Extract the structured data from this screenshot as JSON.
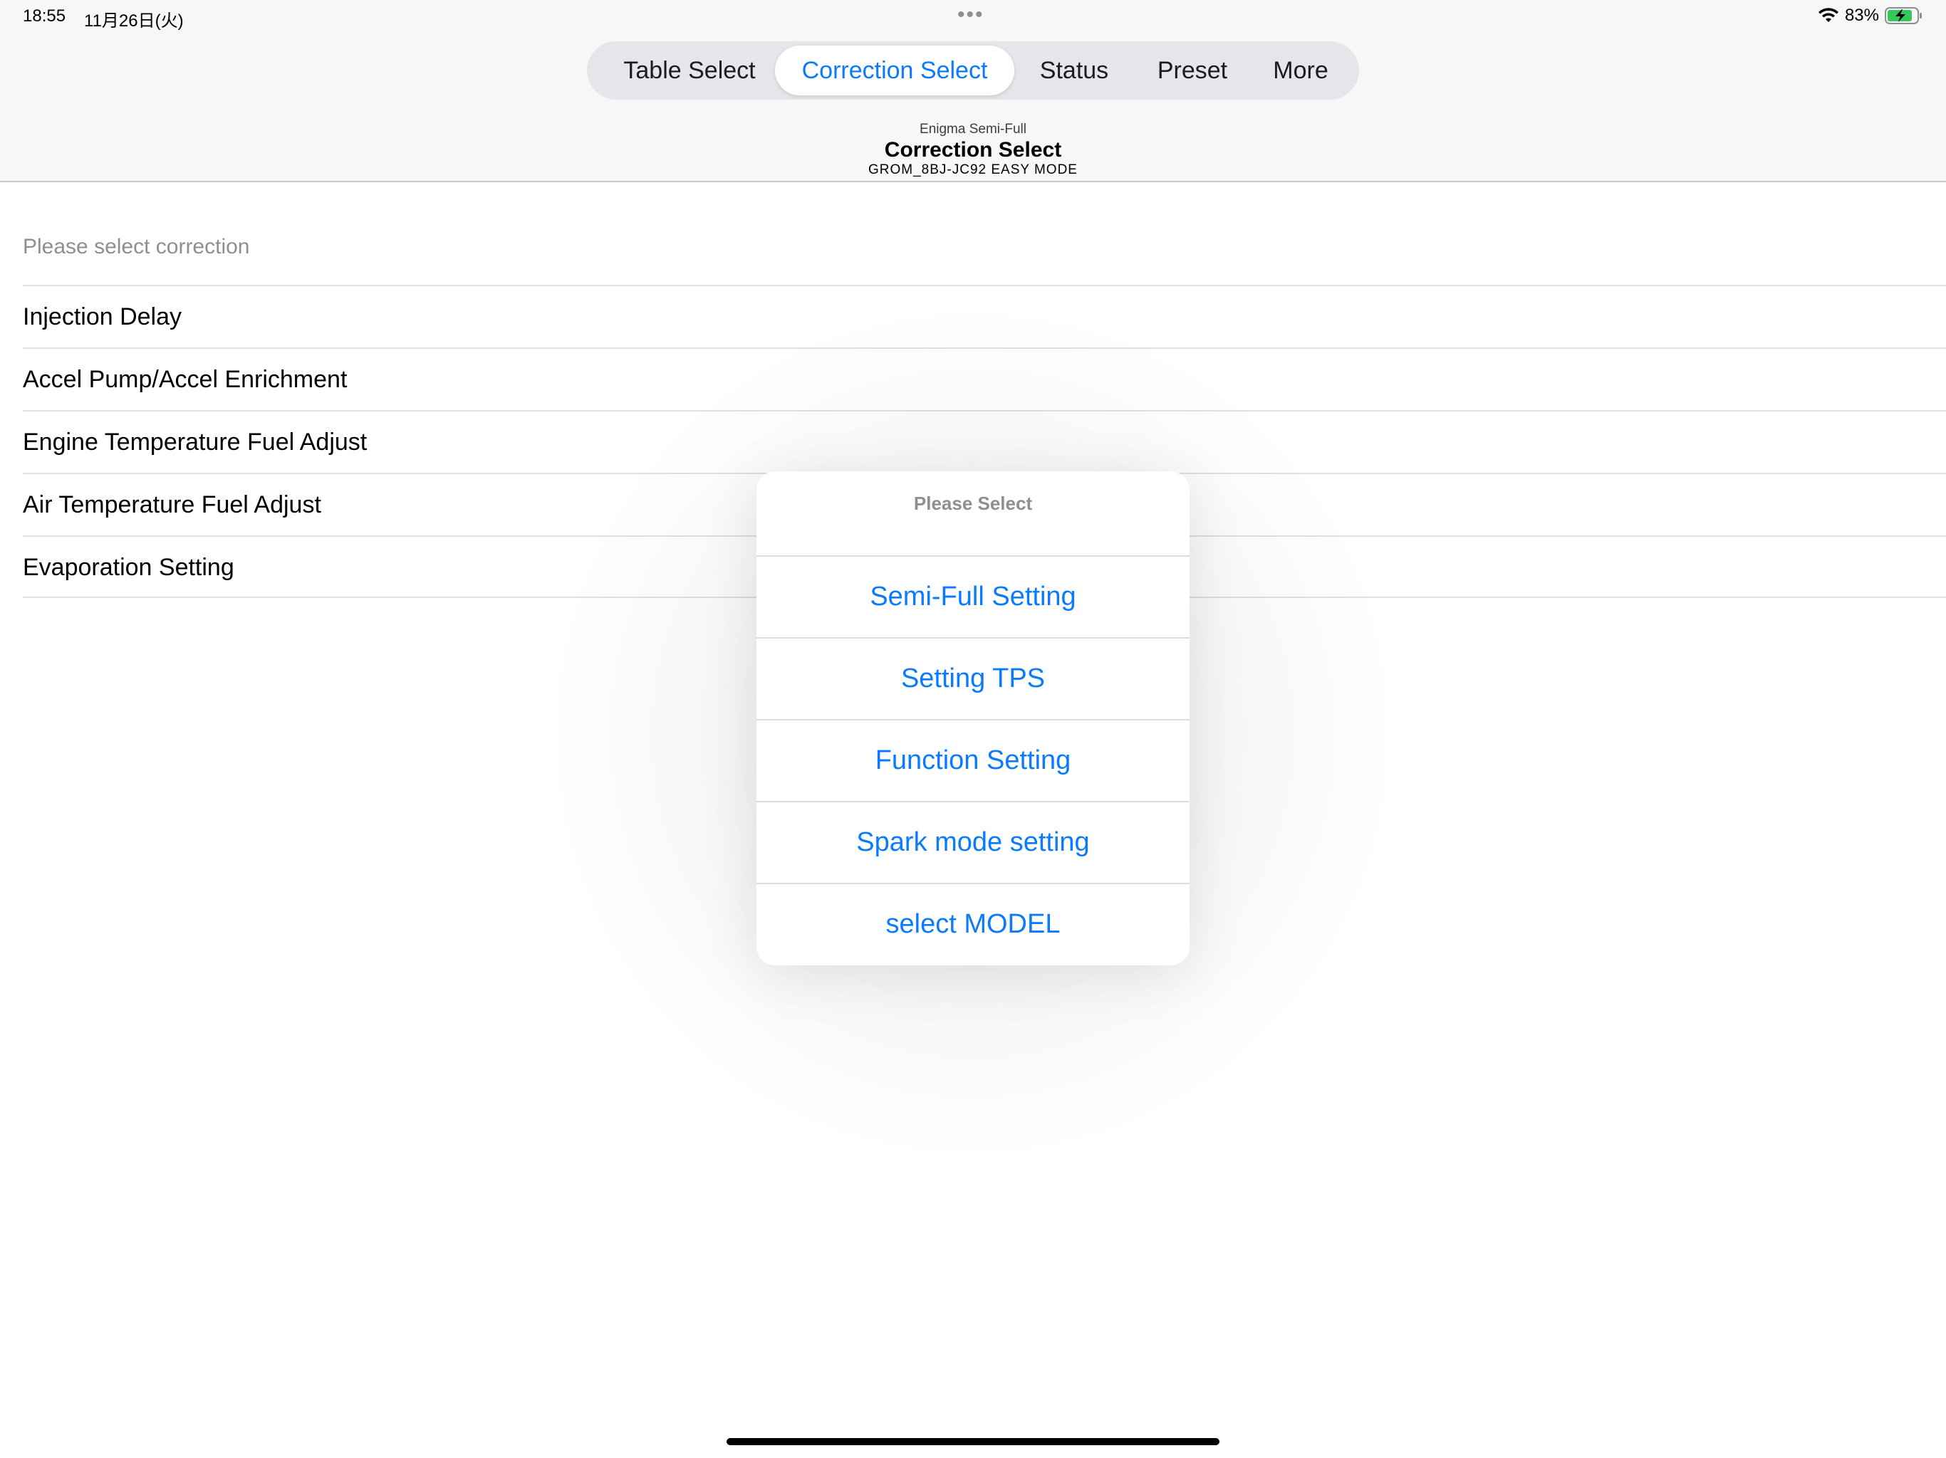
{
  "status_bar": {
    "time": "18:55",
    "date": "11月26日(火)",
    "battery_percent": "83%",
    "dots": "•••"
  },
  "segmented": {
    "tabs": [
      {
        "label": "Table Select",
        "selected": false
      },
      {
        "label": "Correction Select",
        "selected": true
      },
      {
        "label": "Status",
        "selected": false
      },
      {
        "label": "Preset",
        "selected": false
      },
      {
        "label": "More",
        "selected": false
      }
    ]
  },
  "title": {
    "subtitle": "Enigma Semi-Full",
    "main": "Correction Select",
    "model": "GROM_8BJ-JC92 EASY MODE"
  },
  "list": {
    "header": "Please select correction",
    "items": [
      "Injection Delay",
      "Accel Pump/Accel Enrichment",
      "Engine Temperature Fuel Adjust",
      "Air Temperature Fuel Adjust",
      "Evaporation Setting"
    ]
  },
  "alert": {
    "title": "Please Select",
    "options": [
      "Semi-Full Setting",
      "Setting TPS",
      "Function Setting",
      "Spark mode setting",
      "select MODEL"
    ]
  },
  "colors": {
    "accent": "#0a7aff",
    "header_bg": "#f7f7f7",
    "battery_fill": "#34c759"
  }
}
